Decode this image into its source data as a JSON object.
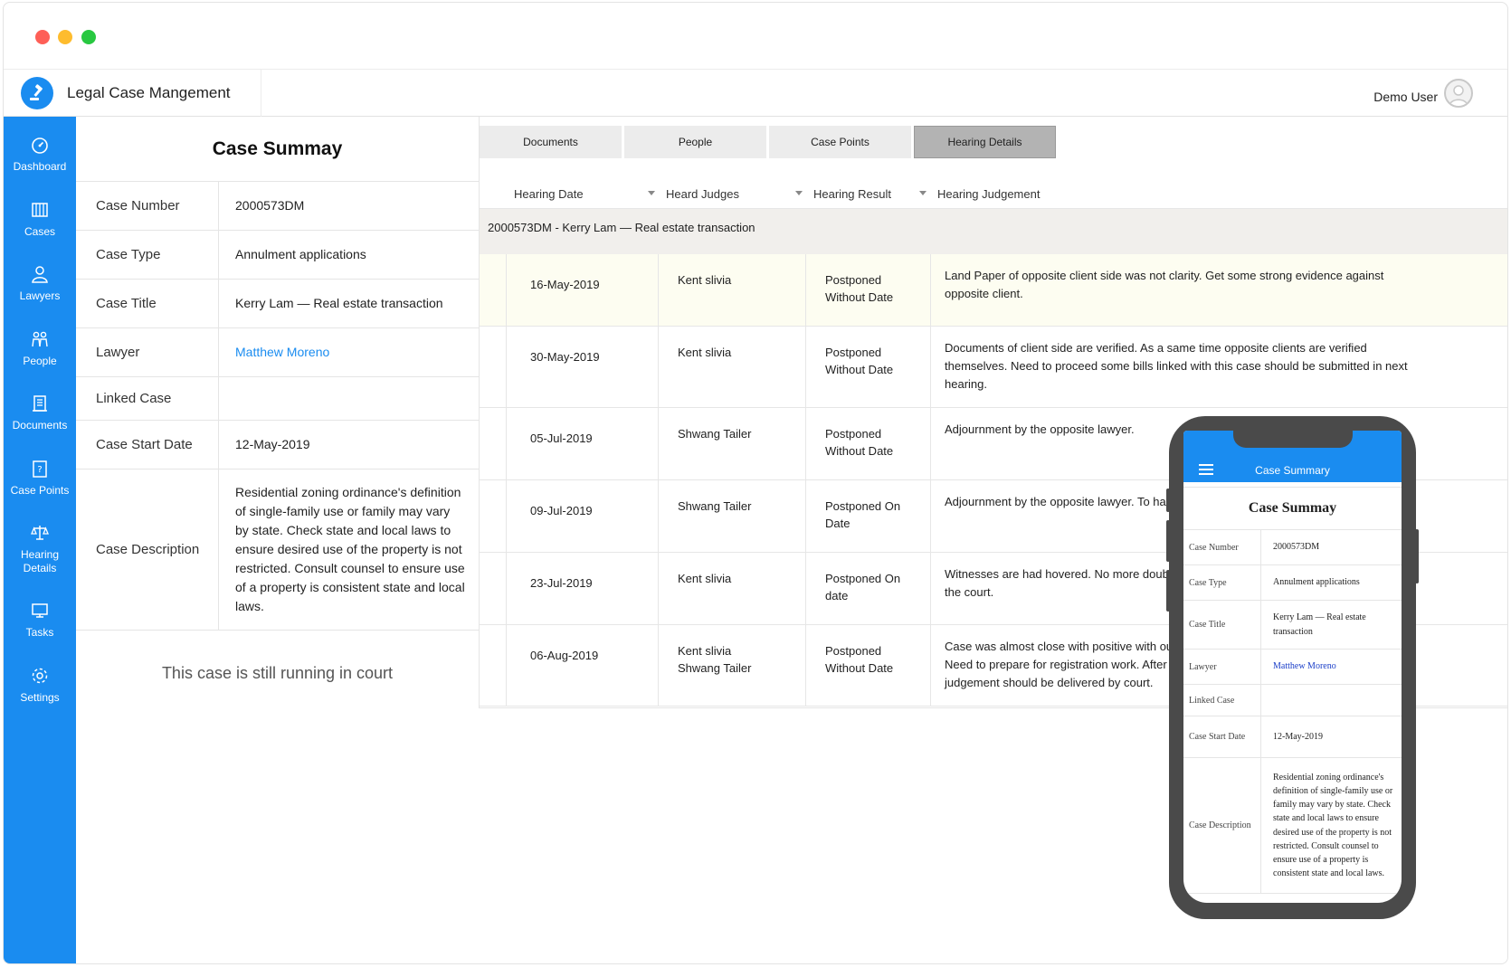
{
  "app": {
    "title": "Legal Case Mangement",
    "user": "Demo User"
  },
  "sidebar": {
    "items": [
      {
        "label": "Dashboard",
        "icon": "dashboard-icon"
      },
      {
        "label": "Cases",
        "icon": "cases-icon"
      },
      {
        "label": "Lawyers",
        "icon": "lawyer-icon"
      },
      {
        "label": "People",
        "icon": "people-icon"
      },
      {
        "label": "Documents",
        "icon": "documents-icon"
      },
      {
        "label": "Case Points",
        "icon": "case-points-icon"
      },
      {
        "label": "Hearing Details",
        "icon": "scales-icon"
      },
      {
        "label": "Tasks",
        "icon": "monitor-icon"
      },
      {
        "label": "Settings",
        "icon": "gear-icon"
      }
    ]
  },
  "summary": {
    "title": "Case Summay",
    "rows": [
      {
        "label": "Case Number",
        "value": "2000573DM"
      },
      {
        "label": "Case Type",
        "value": "Annulment applications"
      },
      {
        "label": "Case Title",
        "value": "Kerry Lam — Real estate transaction"
      },
      {
        "label": "Lawyer",
        "value": "Matthew Moreno"
      },
      {
        "label": "Linked Case",
        "value": ""
      },
      {
        "label": "Case Start Date",
        "value": "12-May-2019"
      },
      {
        "label": "Case Description",
        "value": "Residential zoning ordinance's definition of single-family use or family may vary by state. Check state and local laws to ensure desired use of the property is not restricted. Consult counsel to ensure use of a property is consistent state and local laws."
      }
    ],
    "status": "This case is still running in court"
  },
  "tabs": [
    "Documents",
    "People",
    "Case Points",
    "Hearing Details"
  ],
  "hearing": {
    "columns": [
      "Hearing Date",
      "Heard Judges",
      "Hearing Result",
      "Hearing Judgement"
    ],
    "group": "2000573DM - Kerry Lam — Real estate transaction",
    "rows": [
      {
        "date": "16-May-2019",
        "judges": [
          "Kent slivia"
        ],
        "result": [
          "Postponed",
          "Without Date"
        ],
        "judgement": [
          "Land Paper of opposite client side was not clarity. Get some strong evidence against",
          "opposite client."
        ]
      },
      {
        "date": "30-May-2019",
        "judges": [
          "Kent slivia"
        ],
        "result": [
          "Postponed",
          "Without Date"
        ],
        "judgement": [
          "Documents of client side are verified. As a same time opposite clients are verified",
          "themselves. Need to proceed some bills linked with this case should be submitted in next",
          "hearing."
        ]
      },
      {
        "date": "05-Jul-2019",
        "judges": [
          "Shwang Tailer"
        ],
        "result": [
          "Postponed",
          "Without Date"
        ],
        "judgement": [
          "Adjournment by the opposite lawyer."
        ]
      },
      {
        "date": "09-Jul-2019",
        "judges": [
          "Shwang Tailer"
        ],
        "result": [
          "Postponed On",
          "Date"
        ],
        "judgement": [
          "Adjournment by the opposite lawyer. To har"
        ]
      },
      {
        "date": "23-Jul-2019",
        "judges": [
          "Kent slivia"
        ],
        "result": [
          "Postponed On",
          "date"
        ],
        "judgement": [
          "Witnesses are had hovered. No more doubt",
          "the court."
        ]
      },
      {
        "date": "06-Aug-2019",
        "judges": [
          "Kent slivia",
          "Shwang Tailer"
        ],
        "result": [
          "Postponed",
          "Without Date"
        ],
        "judgement": [
          "Case was almost close with positive with ou",
          "Need to prepare for registration work. After",
          "judgement should be delivered by court."
        ]
      }
    ]
  },
  "mobile": {
    "bar_title": "Case Summary",
    "title": "Case Summay",
    "rows": [
      {
        "label": "Case Number",
        "value": "2000573DM"
      },
      {
        "label": "Case Type",
        "value": "Annulment applications"
      },
      {
        "label": "Case Title",
        "value": "Kerry Lam — Real estate transaction"
      },
      {
        "label": "Lawyer",
        "value": "Matthew Moreno"
      },
      {
        "label": "Linked Case",
        "value": ""
      },
      {
        "label": "Case Start Date",
        "value": "12-May-2019"
      },
      {
        "label": "Case Description",
        "value": "Residential zoning ordinance's definition of single-family use or family may vary by state. Check state and local laws to ensure desired use of the property is not restricted. Consult counsel to ensure use of a property is consistent state and local laws."
      }
    ]
  },
  "colors": {
    "accent": "#1a8cf0",
    "active_tab": "#b3b3b3",
    "group_row": "#f1efec",
    "highlight_row": "#fdfdf1",
    "phone_frame": "#4a4a4a"
  }
}
